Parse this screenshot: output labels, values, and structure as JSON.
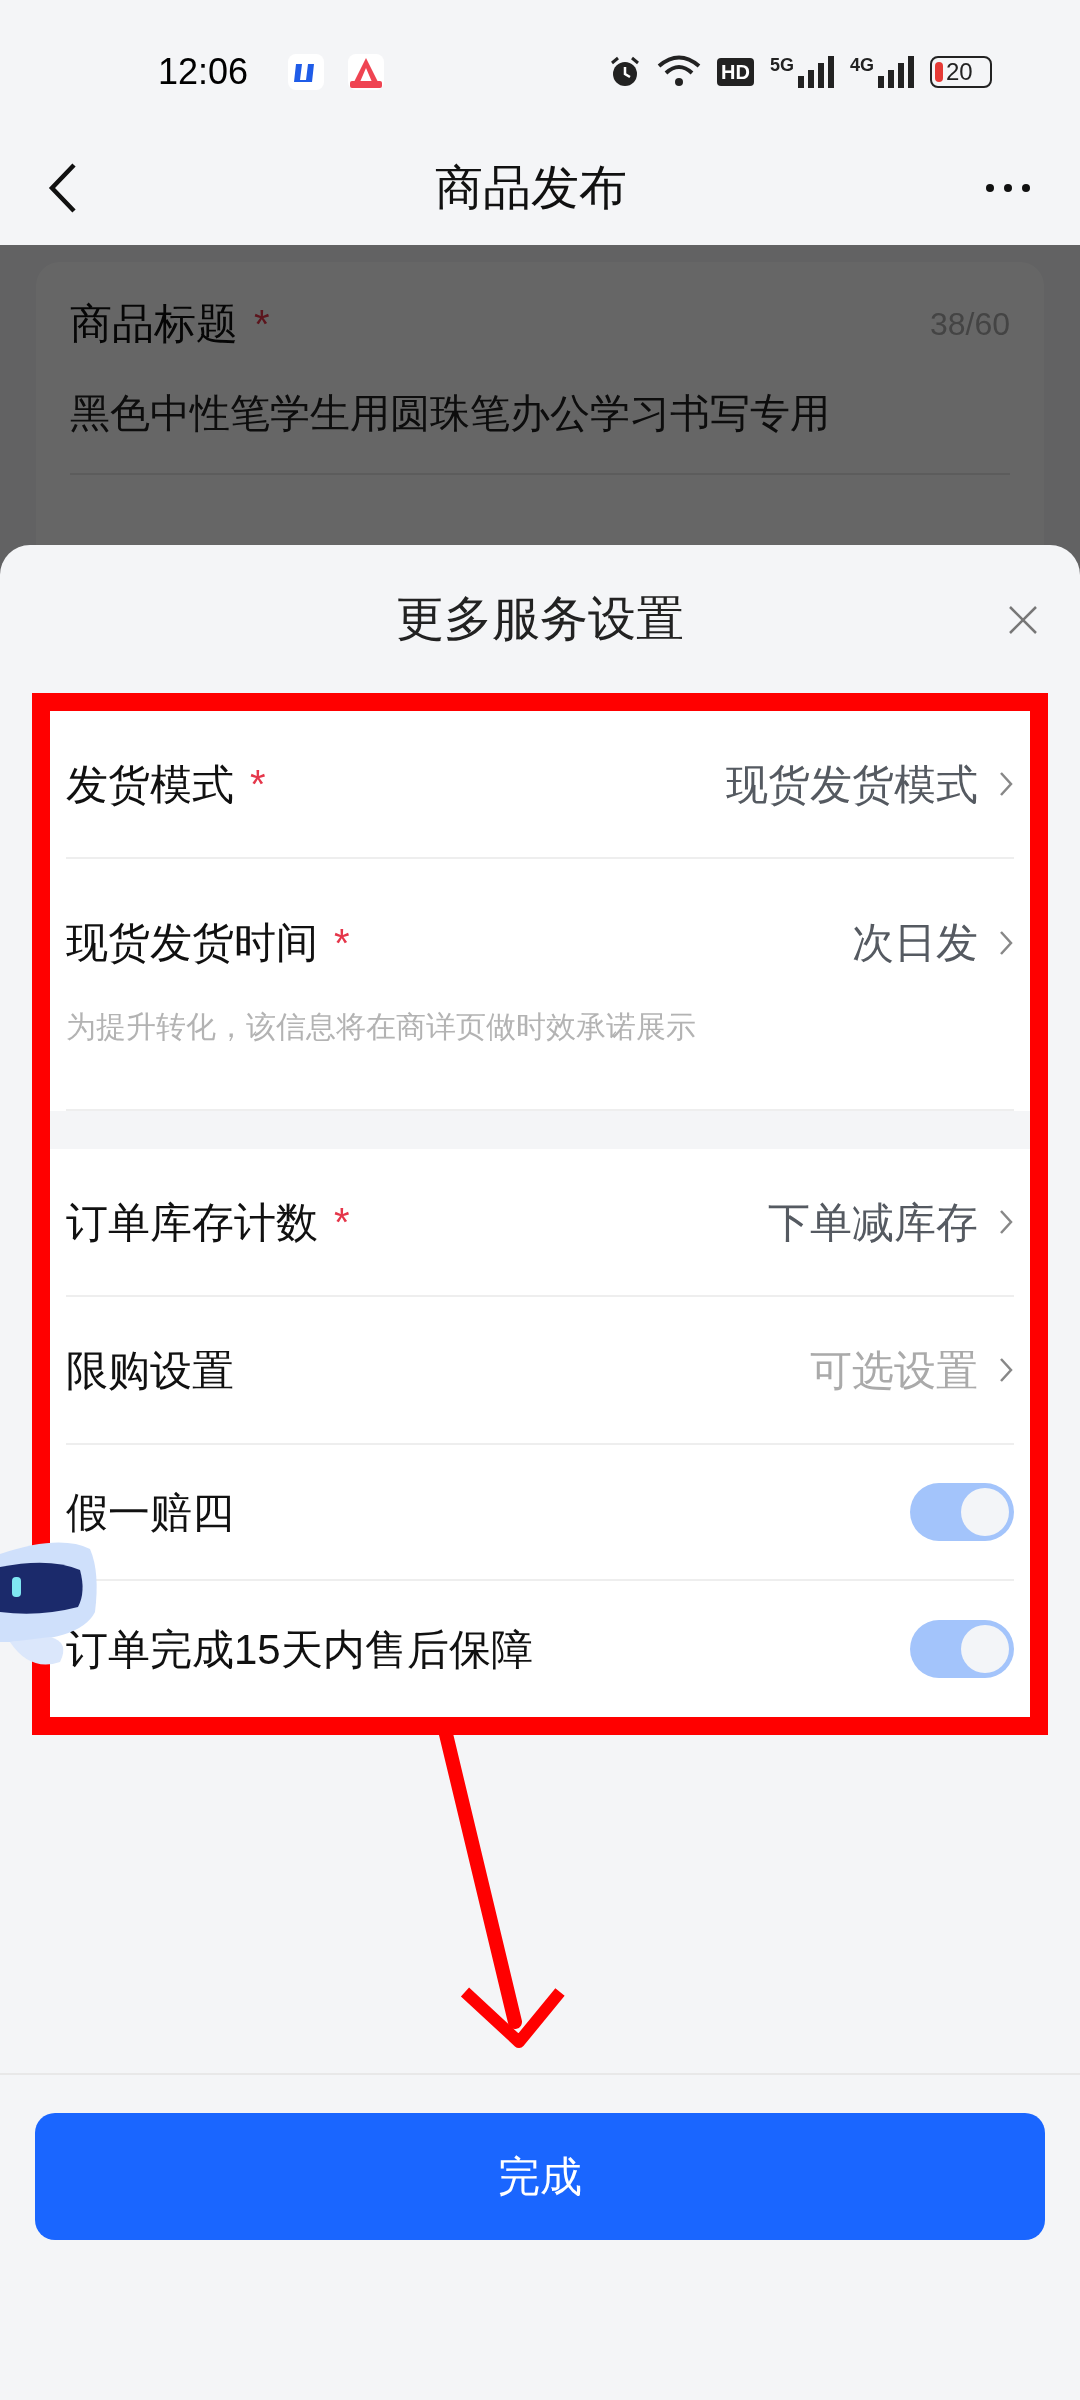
{
  "status_bar": {
    "time": "12:06",
    "hd": "HD",
    "signals": [
      {
        "label": "5G"
      },
      {
        "label": "4G"
      }
    ],
    "battery": "20"
  },
  "header": {
    "title": "商品发布"
  },
  "background_form": {
    "label": "商品标题",
    "required_mark": "*",
    "counter": "38/60",
    "value": "黑色中性笔学生用圆珠笔办公学习书写专用"
  },
  "sheet": {
    "title": "更多服务设置",
    "sections": [
      {
        "rows": [
          {
            "kind": "select",
            "label": "发货模式",
            "required_mark": "*",
            "value": "现货发货模式"
          },
          {
            "kind": "select",
            "label": "现货发货时间",
            "required_mark": "*",
            "value": "次日发",
            "hint": "为提升转化，该信息将在商详页做时效承诺展示"
          }
        ]
      },
      {
        "rows": [
          {
            "kind": "select",
            "label": "订单库存计数",
            "required_mark": "*",
            "value": "下单减库存"
          },
          {
            "kind": "select",
            "label": "限购设置",
            "placeholder": "可选设置"
          },
          {
            "kind": "toggle",
            "label": "假一赔四",
            "on": true
          },
          {
            "kind": "toggle",
            "label": "订单完成15天内售后保障",
            "on": true
          }
        ]
      }
    ]
  },
  "done_button": "完成"
}
